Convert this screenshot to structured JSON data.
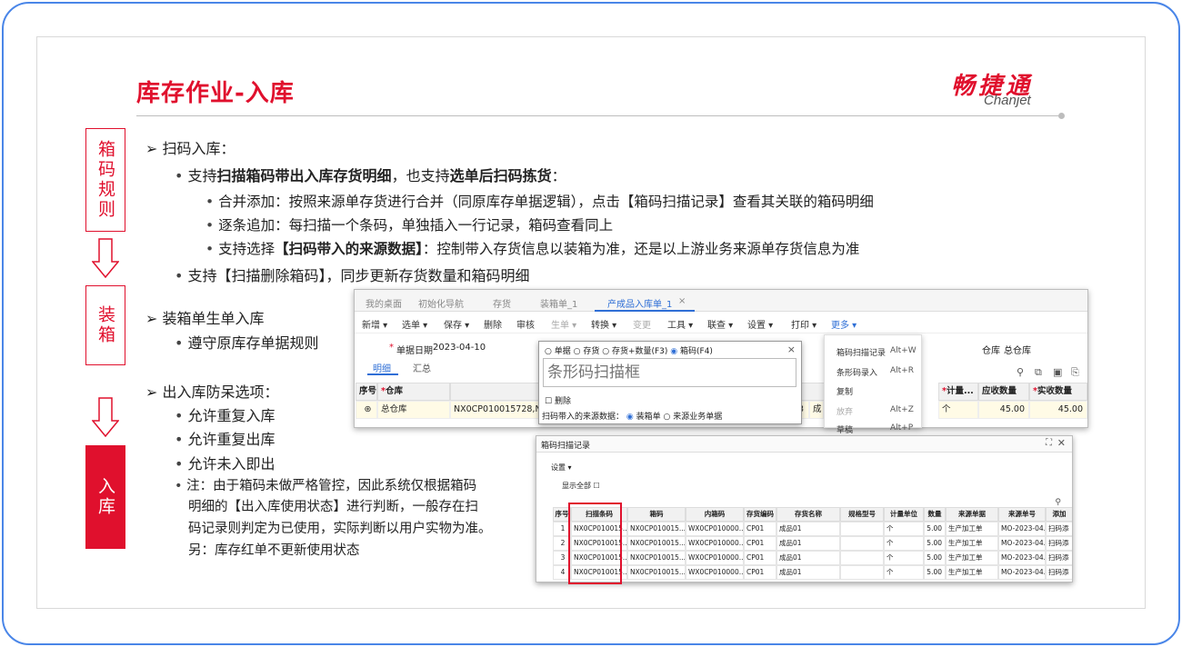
{
  "slide": {
    "title": "库存作业-入库",
    "logo_cn": "畅捷通",
    "logo_en": "Chanjet"
  },
  "side": {
    "step1": "箱码规则",
    "step2": "装箱",
    "step3": "入库"
  },
  "content": {
    "h1": "扫码入库：",
    "l1_pre": "支持",
    "l1_b1": "扫描箱码带出入库存货明细",
    "l1_mid": "，也支持",
    "l1_b2": "选单后扫码拣货",
    "l1_post": "：",
    "l1a": "合并添加：按照来源单存货进行合并（同原库存单据逻辑），点击【箱码扫描记录】查看其关联的箱码明细",
    "l1b": "逐条追加：每扫描一个条码，单独插入一行记录，箱码查看同上",
    "l1c_pre": "支持选择",
    "l1c_b": "【扫码带入的来源数据】",
    "l1c_post": "：控制带入存货信息以装箱为准，还是以上游业务来源单存货信息为准",
    "l2": "支持【扫描删除箱码】，同步更新存货数量和箱码明细",
    "h2": "装箱单生单入库",
    "l3": "遵守原库存单据规则",
    "h3": "出入库防呆选项：",
    "l4": "允许重复入库",
    "l5": "允许重复出库",
    "l6": "允许未入即出",
    "note1": "注：由于箱码未做严格管控，因此系统仅根据箱码",
    "note2": "明细的【出入库使用状态】进行判断，一般存在扫",
    "note3": "码记录则判定为已使用，实际判断以用户实物为准。",
    "note4": "另：库存红单不更新使用状态"
  },
  "shot1": {
    "tabs": [
      "我的桌面",
      "初始化导航",
      "存货",
      "装箱单_1",
      "产成品入库单_1"
    ],
    "close": "×",
    "toolbar": [
      "新增",
      "选单",
      "保存",
      "删除",
      "审核",
      "生单",
      "转换",
      "变更",
      "工具",
      "联查",
      "设置",
      "打印",
      "更多"
    ],
    "date_label": "单据日期",
    "date_value": "2023-04-10",
    "star": "*",
    "subtabs": [
      "明细",
      "汇总"
    ],
    "warehouse_label": "仓库",
    "warehouse_value": "总仓库",
    "grid_headers": [
      "序号",
      "仓库",
      "计量...",
      "应收数量",
      "实收数量"
    ],
    "row": {
      "warehouse": "总仓库",
      "code": "NX0CP010015728,NX",
      "n": "3",
      "x": "成",
      "unit": "个",
      "due": "45.00",
      "actual": "45.00"
    },
    "popup": {
      "radios": [
        "单据",
        "存货",
        "存货+数量(F3)",
        "箱码(F4)"
      ],
      "placeholder": "条形码扫描框",
      "del": "删除",
      "src_label": "扫码带入的来源数据：",
      "src1": "装箱单",
      "src2": "来源业务单据"
    },
    "menu": [
      {
        "label": "箱码扫描记录",
        "key": "Alt+W"
      },
      {
        "label": "条形码录入",
        "key": "Alt+R"
      },
      {
        "label": "复制",
        "key": ""
      },
      {
        "label": "放弃",
        "key": "Alt+Z"
      },
      {
        "label": "草稿",
        "key": "Alt+P"
      }
    ]
  },
  "shot2": {
    "title": "箱码扫描记录",
    "settings": "设置",
    "show_all": "显示全部",
    "headers": [
      "序号",
      "扫描条码",
      "箱码",
      "内箱码",
      "存货编码",
      "存货名称",
      "规格型号",
      "计量单位",
      "数量",
      "来源单据",
      "来源单号",
      "添加"
    ],
    "rows": [
      [
        "1",
        "NX0CP010015...",
        "NX0CP010015...",
        "WX0CP010000...",
        "CP01",
        "成品01",
        "",
        "个",
        "5.00",
        "生产加工单",
        "MO-2023-04...",
        "扫码添"
      ],
      [
        "2",
        "NX0CP010015...",
        "NX0CP010015...",
        "WX0CP010000...",
        "CP01",
        "成品01",
        "",
        "个",
        "5.00",
        "生产加工单",
        "MO-2023-04...",
        "扫码添"
      ],
      [
        "3",
        "NX0CP010015...",
        "NX0CP010015...",
        "WX0CP010000...",
        "CP01",
        "成品01",
        "",
        "个",
        "5.00",
        "生产加工单",
        "MO-2023-04...",
        "扫码添"
      ],
      [
        "4",
        "NX0CP010015...",
        "NX0CP010015...",
        "WX0CP010000...",
        "CP01",
        "成品01",
        "",
        "个",
        "5.00",
        "生产加工单",
        "MO-2023-04...",
        "扫码添"
      ]
    ]
  }
}
